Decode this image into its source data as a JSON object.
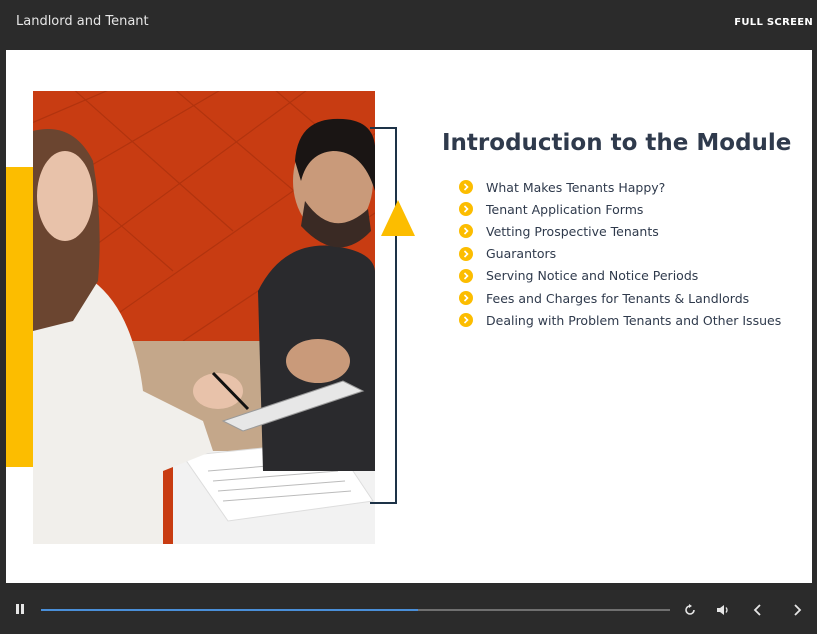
{
  "app": {
    "title": "Landlord and Tenant",
    "fullscreen_label": "FULL SCREEN"
  },
  "slide": {
    "heading": "Introduction to the Module",
    "items": [
      "What Makes Tenants Happy?",
      "Tenant Application Forms",
      "Vetting Prospective Tenants",
      "Guarantors",
      "Serving Notice and Notice Periods",
      "Fees and Charges for Tenants & Landlords",
      "Dealing with Problem Tenants and Other Issues"
    ],
    "photo_desc": "photo",
    "accent_color": "#fcbd00",
    "frame_color": "#1d3247"
  },
  "player": {
    "progress": 0.6,
    "icons": [
      "pause-icon",
      "replay-icon",
      "volume-icon",
      "previous-icon",
      "next-icon"
    ]
  }
}
